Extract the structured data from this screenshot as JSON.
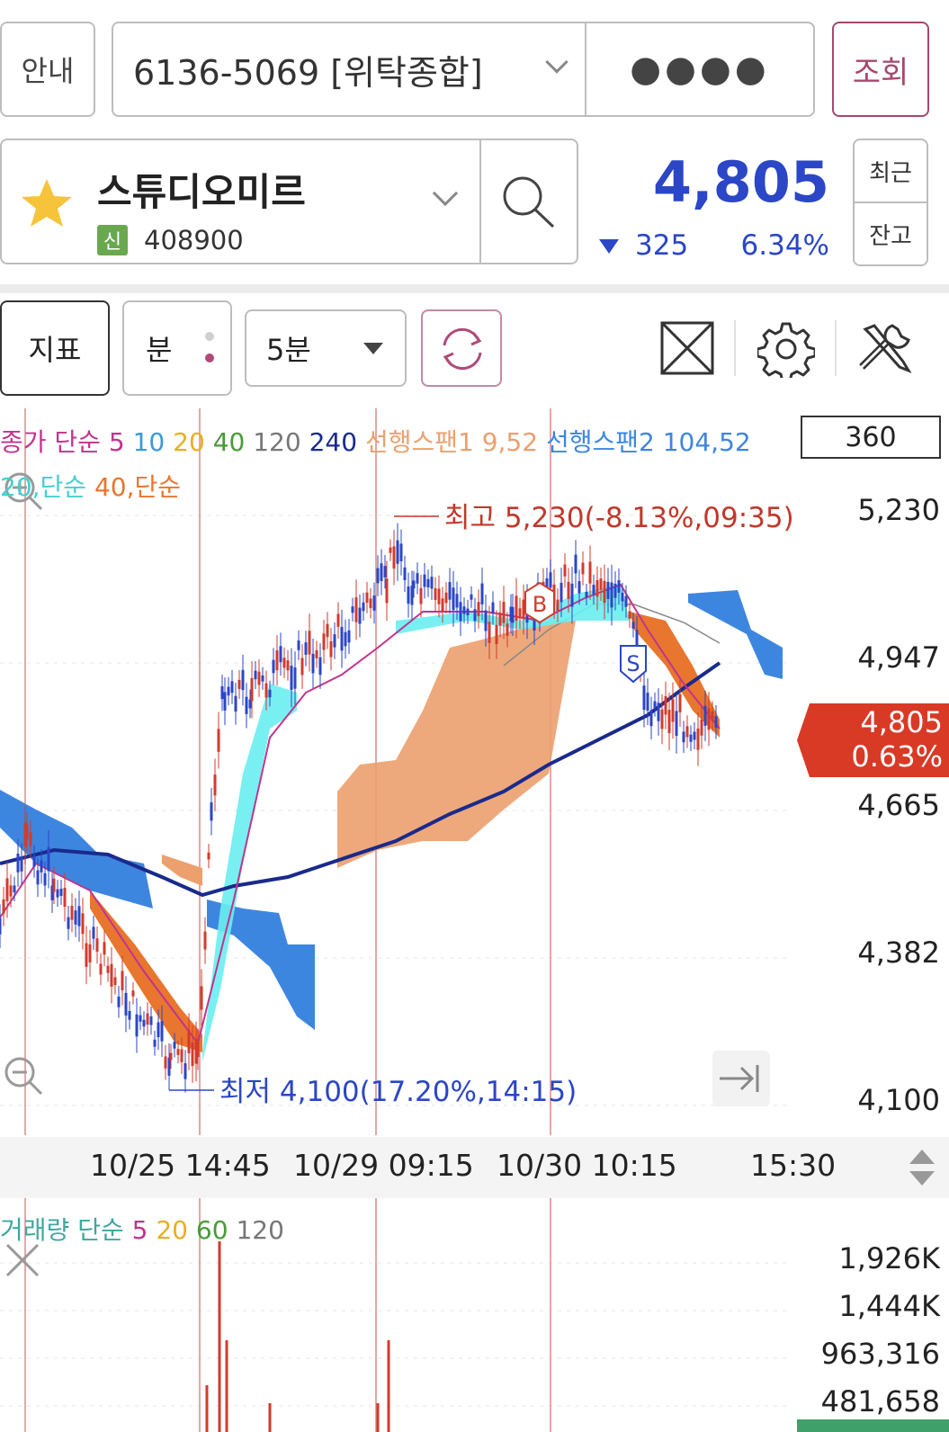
{
  "top_bar": {
    "guide_label": "안내",
    "account": "6136-5069 [위탁종합]",
    "password_mask": "●●●●",
    "query_label": "조회"
  },
  "stock": {
    "name": "스튜디오미르",
    "badge": "신",
    "code": "408900",
    "price": "4,805",
    "change": "325",
    "change_pct": "6.34%",
    "direction": "down",
    "recent_label": "최근",
    "balance_label": "잔고"
  },
  "toolbar": {
    "indicator_label": "지표",
    "minute_label": "분",
    "interval": "5분",
    "icons": [
      "refresh-icon",
      "expand-icon",
      "gear-icon",
      "tools-icon"
    ]
  },
  "chart": {
    "legend": {
      "price_prefix": "종가 단순",
      "ma_periods": [
        "5",
        "10",
        "20",
        "40",
        "120",
        "240"
      ],
      "ma_colors": [
        "#c2338f",
        "#3b9ad9",
        "#e8b020",
        "#4a9a3a",
        "#777777",
        "#1a2a8c"
      ],
      "span1_label": "선행스팬1 9,52",
      "span2_label": "선행스팬2 104,52",
      "band_a": "20,단순",
      "band_b": "40,단순"
    },
    "period_input": "360",
    "price_ticks": [
      "5,230",
      "4,947",
      "4,665",
      "4,382",
      "4,100"
    ],
    "high_label": "최고 5,230(-8.13%,09:35)",
    "low_label": "최저 4,100(17.20%,14:15)",
    "current_price": "4,805",
    "current_pct": "0.63%",
    "buy_marker": "B",
    "sell_marker": "S",
    "x_labels": [
      "10/25 14:45",
      "10/29 09:15",
      "10/30 10:15",
      "15:30"
    ]
  },
  "volume": {
    "legend_prefix": "거래량 단순",
    "ma_periods": [
      "5",
      "20",
      "60",
      "120"
    ],
    "ticks": [
      "1,926K",
      "1,444K",
      "963,316",
      "481,658"
    ]
  },
  "colors": {
    "accent_blue": "#2b46c6",
    "query_border": "#a5486e",
    "current_tag": "#d83a26",
    "span_orange": "#eba06e",
    "span_blue": "#3d86e0",
    "ma240_navy": "#1a2a8c"
  }
}
